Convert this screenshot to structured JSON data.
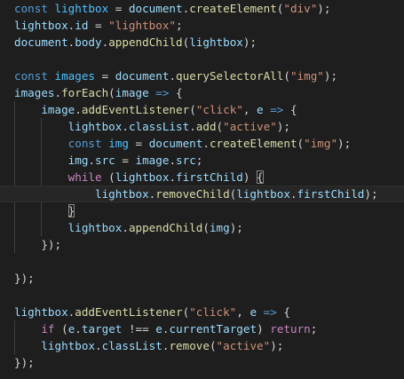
{
  "editor": {
    "language": "javascript",
    "theme": "dark",
    "colors": {
      "background": "#1e1e1e",
      "keyword": "#569cd6",
      "control": "#c586c0",
      "variable": "#9cdcfe",
      "constant": "#4fc1ff",
      "function": "#dcdcaa",
      "string": "#ce9178",
      "plain": "#d4d4d4"
    },
    "lines": [
      [
        [
          "kw",
          "const"
        ],
        [
          "p",
          " "
        ],
        [
          "const",
          "lightbox"
        ],
        [
          "p",
          " = "
        ],
        [
          "var",
          "document"
        ],
        [
          "p",
          "."
        ],
        [
          "fn",
          "createElement"
        ],
        [
          "p",
          "("
        ],
        [
          "str",
          "\"div\""
        ],
        [
          "p",
          ");"
        ]
      ],
      [
        [
          "var",
          "lightbox"
        ],
        [
          "p",
          "."
        ],
        [
          "var",
          "id"
        ],
        [
          "p",
          " = "
        ],
        [
          "str",
          "\"lightbox\""
        ],
        [
          "p",
          ";"
        ]
      ],
      [
        [
          "var",
          "document"
        ],
        [
          "p",
          "."
        ],
        [
          "var",
          "body"
        ],
        [
          "p",
          "."
        ],
        [
          "fn",
          "appendChild"
        ],
        [
          "p",
          "("
        ],
        [
          "var",
          "lightbox"
        ],
        [
          "p",
          ");"
        ]
      ],
      [],
      [
        [
          "kw",
          "const"
        ],
        [
          "p",
          " "
        ],
        [
          "const",
          "images"
        ],
        [
          "p",
          " = "
        ],
        [
          "var",
          "document"
        ],
        [
          "p",
          "."
        ],
        [
          "fn",
          "querySelectorAll"
        ],
        [
          "p",
          "("
        ],
        [
          "str",
          "\"img\""
        ],
        [
          "p",
          ");"
        ]
      ],
      [
        [
          "var",
          "images"
        ],
        [
          "p",
          "."
        ],
        [
          "fn",
          "forEach"
        ],
        [
          "p",
          "("
        ],
        [
          "var",
          "image"
        ],
        [
          "p",
          " "
        ],
        [
          "kw",
          "=>"
        ],
        [
          "p",
          " {"
        ]
      ],
      [
        [
          "p",
          "    "
        ],
        [
          "var",
          "image"
        ],
        [
          "p",
          "."
        ],
        [
          "fn",
          "addEventListener"
        ],
        [
          "p",
          "("
        ],
        [
          "str",
          "\"click\""
        ],
        [
          "p",
          ", "
        ],
        [
          "var",
          "e"
        ],
        [
          "p",
          " "
        ],
        [
          "kw",
          "=>"
        ],
        [
          "p",
          " {"
        ]
      ],
      [
        [
          "p",
          "        "
        ],
        [
          "var",
          "lightbox"
        ],
        [
          "p",
          "."
        ],
        [
          "var",
          "classList"
        ],
        [
          "p",
          "."
        ],
        [
          "fn",
          "add"
        ],
        [
          "p",
          "("
        ],
        [
          "str",
          "\"active\""
        ],
        [
          "p",
          ");"
        ]
      ],
      [
        [
          "p",
          "        "
        ],
        [
          "kw",
          "const"
        ],
        [
          "p",
          " "
        ],
        [
          "const",
          "img"
        ],
        [
          "p",
          " = "
        ],
        [
          "var",
          "document"
        ],
        [
          "p",
          "."
        ],
        [
          "fn",
          "createElement"
        ],
        [
          "p",
          "("
        ],
        [
          "str",
          "\"img\""
        ],
        [
          "p",
          ");"
        ]
      ],
      [
        [
          "p",
          "        "
        ],
        [
          "var",
          "img"
        ],
        [
          "p",
          "."
        ],
        [
          "var",
          "src"
        ],
        [
          "p",
          " = "
        ],
        [
          "var",
          "image"
        ],
        [
          "p",
          "."
        ],
        [
          "var",
          "src"
        ],
        [
          "p",
          ";"
        ]
      ],
      [
        [
          "p",
          "        "
        ],
        [
          "ctl",
          "while"
        ],
        [
          "p",
          " ("
        ],
        [
          "var",
          "lightbox"
        ],
        [
          "p",
          "."
        ],
        [
          "var",
          "firstChild"
        ],
        [
          "p",
          ") "
        ],
        [
          "pm",
          "{"
        ]
      ],
      [
        [
          "p",
          "            "
        ],
        [
          "var",
          "lightbox"
        ],
        [
          "p",
          "."
        ],
        [
          "fn",
          "removeChild"
        ],
        [
          "p",
          "("
        ],
        [
          "var",
          "lightbox"
        ],
        [
          "p",
          "."
        ],
        [
          "var",
          "firstChild"
        ],
        [
          "p",
          ");"
        ]
      ],
      [
        [
          "p",
          "        "
        ],
        [
          "pm",
          "}"
        ]
      ],
      [
        [
          "p",
          "        "
        ],
        [
          "var",
          "lightbox"
        ],
        [
          "p",
          "."
        ],
        [
          "fn",
          "appendChild"
        ],
        [
          "p",
          "("
        ],
        [
          "var",
          "img"
        ],
        [
          "p",
          ");"
        ]
      ],
      [
        [
          "p",
          "    });"
        ]
      ],
      [],
      [
        [
          "p",
          "});"
        ]
      ],
      [],
      [
        [
          "var",
          "lightbox"
        ],
        [
          "p",
          "."
        ],
        [
          "fn",
          "addEventListener"
        ],
        [
          "p",
          "("
        ],
        [
          "str",
          "\"click\""
        ],
        [
          "p",
          ", "
        ],
        [
          "var",
          "e"
        ],
        [
          "p",
          " "
        ],
        [
          "kw",
          "=>"
        ],
        [
          "p",
          " {"
        ]
      ],
      [
        [
          "p",
          "    "
        ],
        [
          "ctl",
          "if"
        ],
        [
          "p",
          " ("
        ],
        [
          "var",
          "e"
        ],
        [
          "p",
          "."
        ],
        [
          "var",
          "target"
        ],
        [
          "p",
          " !== "
        ],
        [
          "var",
          "e"
        ],
        [
          "p",
          "."
        ],
        [
          "var",
          "currentTarget"
        ],
        [
          "p",
          ") "
        ],
        [
          "ctl",
          "return"
        ],
        [
          "p",
          ";"
        ]
      ],
      [
        [
          "p",
          "    "
        ],
        [
          "var",
          "lightbox"
        ],
        [
          "p",
          "."
        ],
        [
          "var",
          "classList"
        ],
        [
          "p",
          "."
        ],
        [
          "fn",
          "remove"
        ],
        [
          "p",
          "("
        ],
        [
          "str",
          "\"active\""
        ],
        [
          "p",
          ");"
        ]
      ],
      [
        [
          "p",
          "});"
        ]
      ]
    ],
    "current_line": 11
  }
}
